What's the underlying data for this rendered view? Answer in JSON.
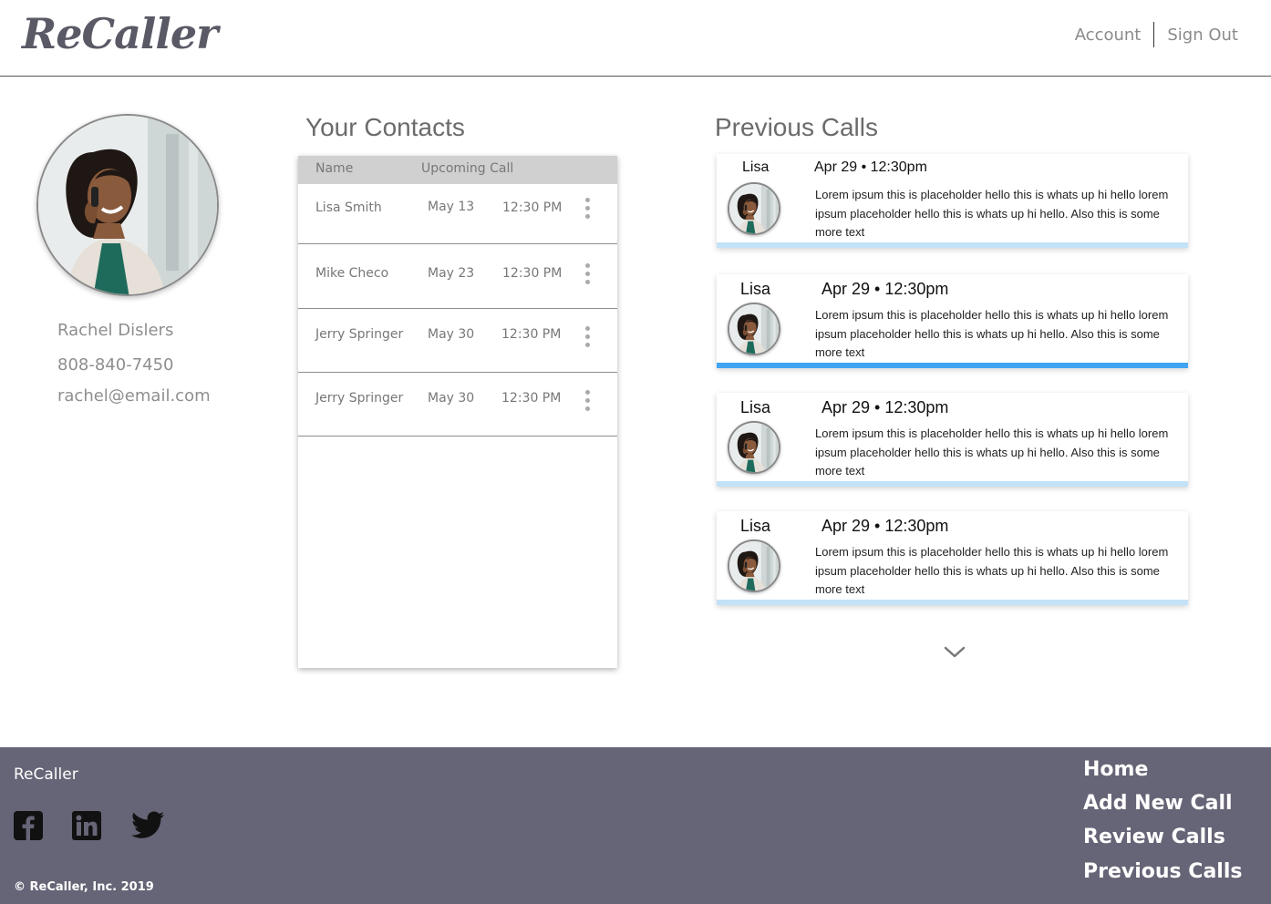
{
  "header": {
    "logo": "ReCaller",
    "account_label": "Account",
    "signout_label": "Sign Out"
  },
  "profile": {
    "name": "Rachel Dislers",
    "phone": "808-840-7450",
    "email": "rachel@email.com"
  },
  "contacts": {
    "title": "Your Contacts",
    "columns": {
      "name": "Name",
      "upcoming": "Upcoming Call"
    },
    "rows": [
      {
        "name": "Lisa Smith",
        "date": "May 13",
        "time": "12:30 PM"
      },
      {
        "name": "Mike Checo",
        "date": "May 23",
        "time": "12:30 PM"
      },
      {
        "name": "Jerry Springer",
        "date": "May 30",
        "time": "12:30 PM"
      },
      {
        "name": "Jerry Springer",
        "date": "May 30",
        "time": "12:30 PM"
      }
    ]
  },
  "calls": {
    "title": "Previous Calls",
    "items": [
      {
        "name": "Lisa",
        "datetime": "Apr 29 • 12:30pm",
        "text": "Lorem ipsum this is placeholder hello this is whats up hi hello lorem ipsum  placeholder hello this is whats up hi hello. Also this is some more text"
      },
      {
        "name": "Lisa",
        "datetime": "Apr 29 • 12:30pm",
        "text": "Lorem ipsum this is placeholder hello this is whats up hi hello lorem ipsum  placeholder hello this is whats up hi hello. Also this is some more text"
      },
      {
        "name": "Lisa",
        "datetime": "Apr 29 • 12:30pm",
        "text": "Lorem ipsum this is placeholder hello this is whats up hi hello lorem ipsum  placeholder hello this is whats up hi hello. Also this is some more text"
      },
      {
        "name": "Lisa",
        "datetime": "Apr 29 • 12:30pm",
        "text": "Lorem ipsum this is placeholder hello this is whats up hi hello lorem ipsum  placeholder hello this is whats up hi hello. Also this is some more text"
      }
    ]
  },
  "footer": {
    "brand": "ReCaller",
    "copyright": "© ReCaller, Inc. 2019",
    "social": [
      "facebook-icon",
      "linkedin-icon",
      "twitter-icon"
    ],
    "nav": [
      "Home",
      "Add New Call",
      "Review Calls",
      "Previous Calls"
    ]
  },
  "colors": {
    "header_border": "#555555",
    "footer_bg": "#666577",
    "active_bar": "#41a4f2",
    "inactive_bar": "#c3e2f7",
    "table_header": "#d0d0d0"
  }
}
